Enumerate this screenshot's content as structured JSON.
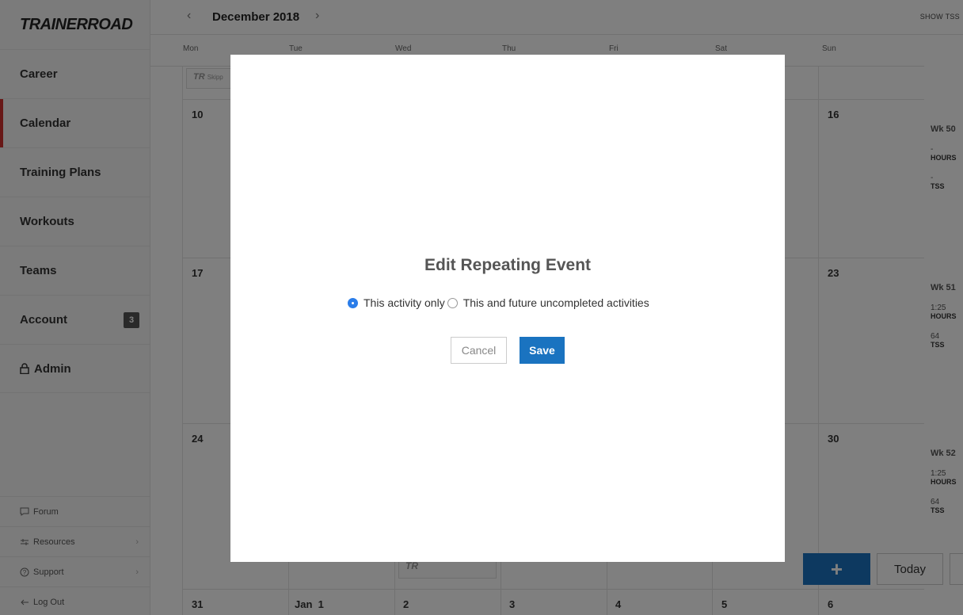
{
  "app": {
    "logo": "TRAINERROAD"
  },
  "sidebar": {
    "items": [
      {
        "label": "Career"
      },
      {
        "label": "Calendar"
      },
      {
        "label": "Training Plans"
      },
      {
        "label": "Workouts"
      },
      {
        "label": "Teams"
      },
      {
        "label": "Account",
        "badge": "3"
      },
      {
        "label": "Admin"
      }
    ],
    "footer": [
      {
        "label": "Forum",
        "icon": "chat-icon"
      },
      {
        "label": "Resources",
        "icon": "sliders-icon"
      },
      {
        "label": "Support",
        "icon": "question-icon"
      },
      {
        "label": "Log Out",
        "icon": "arrow-left-icon"
      }
    ],
    "accent_color": "#d0302f"
  },
  "calendar": {
    "month": "December 2018",
    "show_tss": "SHOW TSS",
    "days": [
      "Mon",
      "Tue",
      "Wed",
      "Thu",
      "Fri",
      "Sat",
      "Sun"
    ],
    "rows": [
      {
        "mon": "10",
        "sun": "16"
      },
      {
        "mon": "17",
        "sun": "23"
      },
      {
        "mon": "24",
        "sun": "30"
      },
      {
        "mon": "31",
        "tue": "Jan  1",
        "wed": "2",
        "thu": "3",
        "fri": "4",
        "sat": "5",
        "sun": "6"
      }
    ],
    "week_summaries": [
      {
        "week": "Wk 50",
        "hours": "-",
        "hours_label": "HOURS",
        "tss": "-",
        "tss_label": "TSS"
      },
      {
        "week": "Wk 51",
        "hours": "1:25",
        "hours_label": "HOURS",
        "tss": "64",
        "tss_label": "TSS"
      },
      {
        "week": "Wk 52",
        "hours": "1:25",
        "hours_label": "HOURS",
        "tss": "64",
        "tss_label": "TSS"
      }
    ],
    "tr_card_text": "TR",
    "skipped_text": "Skipp",
    "add_button": "+",
    "today_button": "Today"
  },
  "modal": {
    "title": "Edit Repeating Event",
    "option_1": "This activity only",
    "option_2": "This and future uncompleted activities",
    "selected": "option_1",
    "cancel": "Cancel",
    "save": "Save",
    "primary_color": "#1a73c0"
  }
}
